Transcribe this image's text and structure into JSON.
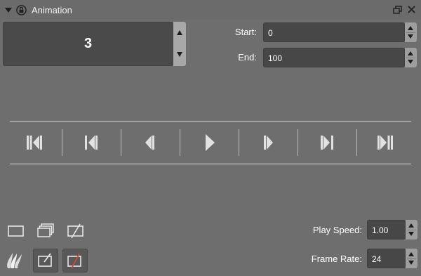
{
  "panel": {
    "title": "Animation"
  },
  "frame": {
    "current": "3"
  },
  "range": {
    "start_label": "Start:",
    "start_value": "0",
    "end_label": "End:",
    "end_value": "100"
  },
  "transport": {
    "buttons": [
      "go-to-start",
      "previous-key",
      "step-back",
      "play",
      "step-forward",
      "next-key",
      "go-to-end"
    ]
  },
  "playback": {
    "speed_label": "Play Speed:",
    "speed_value": "1.00",
    "rate_label": "Frame Rate:",
    "rate_value": "24"
  },
  "colors": {
    "panel_bg": "#6e6e6e",
    "field_bg": "#474747",
    "text": "#ffffff"
  }
}
